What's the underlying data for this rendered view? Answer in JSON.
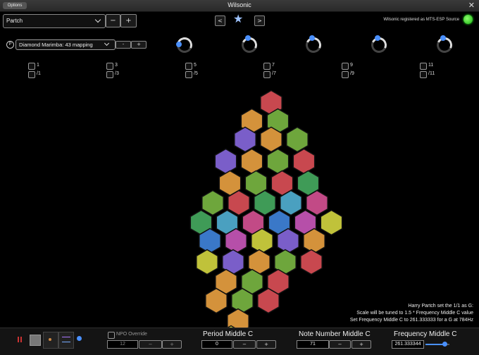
{
  "window": {
    "title": "Wilsonic",
    "options_label": "Options",
    "close_glyph": "✕"
  },
  "header": {
    "favorites_value": "Partch",
    "minus": "−",
    "plus": "+",
    "prev": "<",
    "next": ">",
    "star_glyph": "★",
    "registration": "Wilsonic registered as MTS-ESP Source",
    "led_color": "#33dd22"
  },
  "mapping": {
    "p_label": "P",
    "value": "Diamond Marimba: 43 mapping",
    "minus": "-",
    "plus": "+"
  },
  "checkbox_cols": [
    {
      "top": "1",
      "bottom": "/1"
    },
    {
      "top": "3",
      "bottom": "/3"
    },
    {
      "top": "5",
      "bottom": "/5"
    },
    {
      "top": "7",
      "bottom": "/7"
    },
    {
      "top": "9",
      "bottom": "/9"
    },
    {
      "top": "11",
      "bottom": "/11"
    }
  ],
  "hex_colors": [
    "#c8484f",
    "#7a5ec9",
    "#3a78c8",
    "#3f9b57",
    "#d4923b",
    "#b64fa9",
    "#4aa0c0",
    "#6ea63c",
    "#c0c23a",
    "#c24a86"
  ],
  "info": {
    "line1": "Harry Partch set the 1/1 as G:",
    "line2": "Scale will be tuned to 1.5 * Frequency Middle C value",
    "line3": "Set Frequency Middle C to 261.333333 for a G at 784Hz"
  },
  "bottom": {
    "npo_label": "NPO Override",
    "npo_value": "12",
    "minus": "−",
    "plus": "+",
    "period_title": "Period Middle C",
    "period_value": "0",
    "note_title": "Note Number Middle C",
    "note_value": "71",
    "freq_title": "Frequency Middle C",
    "freq_value": "261.333344",
    "freq_slider_fraction": 0.8
  }
}
